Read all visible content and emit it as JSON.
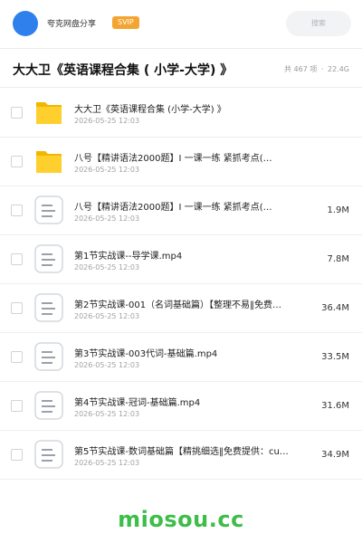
{
  "topbar": {
    "app_name": "夸克网盘分享",
    "badge": "SVIP",
    "search_placeholder": "搜索",
    "accent_color": "#2f80ed",
    "badge_color": "#f4a531"
  },
  "folder": {
    "title": "大大卫《英语课程合集 ( 小学-大学) 》",
    "item_count": "共 467 项",
    "separator": "·",
    "total_size": "22.4G"
  },
  "files": [
    {
      "name": "大大卫《英语课程合集 (小学-大学) 》",
      "date": "2026-05-25 12:03",
      "size": "",
      "icon": "folder-icon"
    },
    {
      "name": "八号【精讲语法2000题】I 一课一练 紧抓考点(…",
      "date": "2026-05-25 12:03",
      "size": "",
      "icon": "folder-icon"
    },
    {
      "name": "八号【精讲语法2000题】I 一课一练 紧抓考点(…",
      "date": "2026-05-25 12:03",
      "size": "1.9M",
      "icon": "document-icon"
    },
    {
      "name": "第1节实战课--导学课.mp4",
      "date": "2026-05-25 12:03",
      "size": "7.8M",
      "icon": "document-icon"
    },
    {
      "name": "第2节实战课-001（名词基础篇）【整理不易‖免费…",
      "date": "2026-05-25 12:03",
      "size": "36.4M",
      "icon": "document-icon"
    },
    {
      "name": "第3节实战课-003代词-基础篇.mp4",
      "date": "2026-05-25 12:03",
      "size": "33.5M",
      "icon": "document-icon"
    },
    {
      "name": "第4节实战课-冠词-基础篇.mp4",
      "date": "2026-05-25 12:03",
      "size": "31.6M",
      "icon": "document-icon"
    },
    {
      "name": "第5节实战课-数词基础篇【精挑细选‖免费提供：cu…",
      "date": "2026-05-25 12:03",
      "size": "34.9M",
      "icon": "document-icon"
    }
  ],
  "watermark": "miosou.cc"
}
